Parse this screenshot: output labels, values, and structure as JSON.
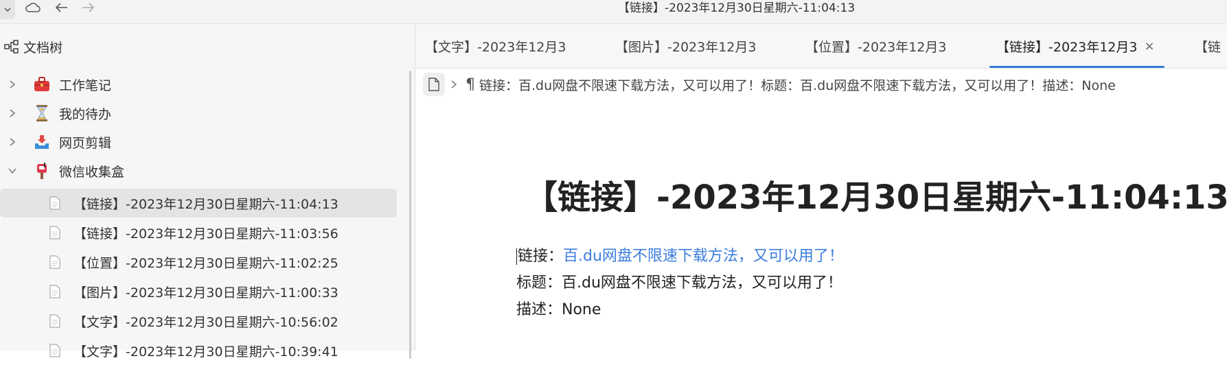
{
  "window": {
    "title": "【链接】-2023年12月30日星期六-11:04:13"
  },
  "toolbar": {
    "icons": [
      "chevron-down-icon",
      "cloud-icon",
      "back-arrow-icon",
      "forward-arrow-icon"
    ]
  },
  "sidebar": {
    "header_label": "文档树",
    "notebooks": [
      {
        "label": "工作笔记",
        "icon": "toolbox-icon",
        "expanded": false
      },
      {
        "label": "我的待办",
        "icon": "hourglass-icon",
        "expanded": false
      },
      {
        "label": "网页剪辑",
        "icon": "inbox-tray-icon",
        "expanded": false
      },
      {
        "label": "微信收集盒",
        "icon": "mailbox-icon",
        "expanded": true
      }
    ],
    "documents": [
      {
        "label": "【链接】-2023年12月30日星期六-11:04:13",
        "selected": true
      },
      {
        "label": "【链接】-2023年12月30日星期六-11:03:56",
        "selected": false
      },
      {
        "label": "【位置】-2023年12月30日星期六-11:02:25",
        "selected": false
      },
      {
        "label": "【图片】-2023年12月30日星期六-11:00:33",
        "selected": false
      },
      {
        "label": "【文字】-2023年12月30日星期六-10:56:02",
        "selected": false
      },
      {
        "label": "【文字】-2023年12月30日星期六-10:39:41",
        "selected": false
      }
    ]
  },
  "tabs": [
    {
      "label": "【文字】-2023年12月3",
      "active": false
    },
    {
      "label": "【图片】-2023年12月3",
      "active": false
    },
    {
      "label": "【位置】-2023年12月3",
      "active": false
    },
    {
      "label": "【链接】-2023年12月3",
      "active": true
    },
    {
      "label": "【链",
      "active": false
    }
  ],
  "breadcrumb": {
    "paragraph_mark": "¶",
    "text": "链接：百.du网盘不限速下载方法，又可以用了！标题：百.du网盘不限速下载方法，又可以用了！描述：None"
  },
  "document": {
    "title": "【链接】-2023年12月30日星期六-11:04:13",
    "link_label": "链接：",
    "link_text": "百.du网盘不限速下载方法，又可以用了！",
    "title_label": "标题：",
    "title_value": "百.du网盘不限速下载方法，又可以用了！",
    "desc_label": "描述：",
    "desc_value": "None"
  },
  "colors": {
    "accent": "#3b7ddd",
    "sidebar_bg": "#f6f6f6",
    "selected_row": "#e4e4e4"
  }
}
